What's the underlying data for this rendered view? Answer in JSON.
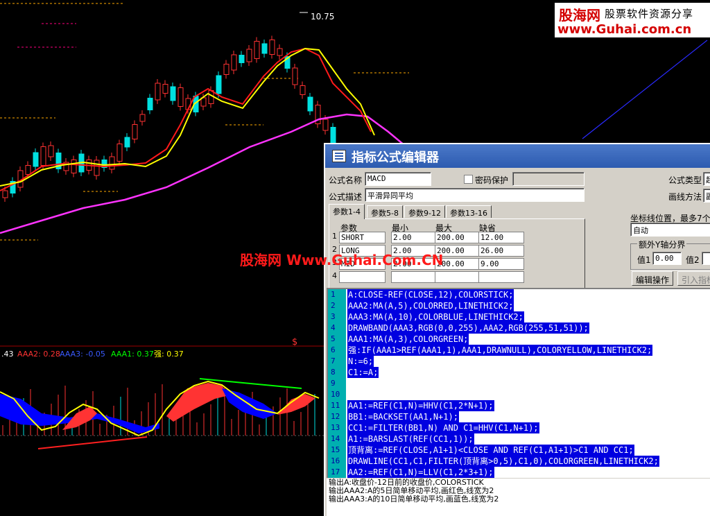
{
  "chart": {
    "price_high_label": "10.75",
    "signal_marker": "$",
    "indicator_legend": {
      "a": ".43",
      "aaa2": "AAA2: 0.28",
      "aaa3": "AAA3: -0.05",
      "aaa1": "AAA1: 0.37",
      "qiang": "强: 0.37"
    },
    "colors": {
      "up_candle": "#ff3232",
      "down_candle": "#00e0e0",
      "ma_red": "#ff1a1a",
      "ma_yellow": "#ffff00",
      "ma_magenta": "#ff33ff",
      "band_red": "#ff3333",
      "band_blue": "#0000ff",
      "green_line": "#00ff00"
    }
  },
  "watermark_top": {
    "brand": "股海网",
    "subtitle": "股票软件资源分享",
    "url": "www.Guhai.com.cn"
  },
  "watermark_center": "股海网 Www.Guhai.Com.CN",
  "dialog": {
    "title": "指标公式编辑器",
    "formula_name_label": "公式名称",
    "formula_name_value": "MACD",
    "password_label": "密码保护",
    "formula_desc_label": "公式描述",
    "formula_desc_value": "平滑异同平均",
    "formula_type_label": "公式类型",
    "formula_type_value": "超",
    "draw_method_label": "画线方法",
    "draw_method_value": "副",
    "tabs": [
      "参数1-4",
      "参数5-8",
      "参数9-12",
      "参数13-16"
    ],
    "param_headers": [
      "参数",
      "最小",
      "最大",
      "缺省"
    ],
    "params": [
      {
        "num": "1",
        "name": "SHORT",
        "min": "2.00",
        "max": "200.00",
        "default": "12.00"
      },
      {
        "num": "2",
        "name": "LONG",
        "min": "2.00",
        "max": "200.00",
        "default": "26.00"
      },
      {
        "num": "3",
        "name": "MID",
        "min": "2.00",
        "max": "200.00",
        "default": "9.00"
      },
      {
        "num": "4",
        "name": "",
        "min": "",
        "max": "",
        "default": ""
      }
    ],
    "axis_pos_label": "坐标线位置，最多7个,用",
    "axis_pos_value": "自动",
    "extra_y_label": "额外Y轴分界",
    "val1_label": "值1",
    "val1_value": "0.00",
    "val2_label": "值2",
    "edit_btn": "编辑操作",
    "import_btn": "引入指标"
  },
  "code_lines": [
    {
      "n": "1",
      "text": "A:CLOSE-REF(CLOSE,12),COLORSTICK;"
    },
    {
      "n": "2",
      "text": "AAA2:MA(A,5),COLORRED,LINETHICK2;"
    },
    {
      "n": "3",
      "text": "AAA3:MA(A,10),COLORBLUE,LINETHICK2;"
    },
    {
      "n": "4",
      "text": "DRAWBAND(AAA3,RGB(0,0,255),AAA2,RGB(255,51,51));"
    },
    {
      "n": "5",
      "text": "AAA1:MA(A,3),COLORGREEN;"
    },
    {
      "n": "6",
      "text": "强:IF(AAA1>REF(AAA1,1),AAA1,DRAWNULL),COLORYELLOW,LINETHICK2;"
    },
    {
      "n": "7",
      "text": "N:=6;"
    },
    {
      "n": "8",
      "text": "C1:=A;"
    },
    {
      "n": "9",
      "text": ""
    },
    {
      "n": "10",
      "text": ""
    },
    {
      "n": "11",
      "text": "AA1:=REF(C1,N)=HHV(C1,2*N+1);"
    },
    {
      "n": "12",
      "text": "BB1:=BACKSET(AA1,N+1);"
    },
    {
      "n": "13",
      "text": "CC1:=FILTER(BB1,N) AND C1=HHV(C1,N+1);"
    },
    {
      "n": "14",
      "text": "A1:=BARSLAST(REF(CC1,1));"
    },
    {
      "n": "15",
      "text": "顶背离:=REF(CLOSE,A1+1)<CLOSE AND REF(C1,A1+1)>C1 AND CC1;"
    },
    {
      "n": "16",
      "text": "DRAWLINE(CC1,C1,FILTER(顶背离>0,5),C1,0),COLORGREEN,LINETHICK2;"
    },
    {
      "n": "17",
      "text": "AA2:=REF(C1,N)=LLV(C1,2*3+1);"
    }
  ],
  "description_lines": [
    "输出A:收盘价-12日前的收盘价,COLORSTICK",
    "输出AAA2:A的5日简单移动平均,画红色,线宽为2",
    "输出AAA3:A的10日简单移动平均,画蓝色,线宽为2"
  ]
}
